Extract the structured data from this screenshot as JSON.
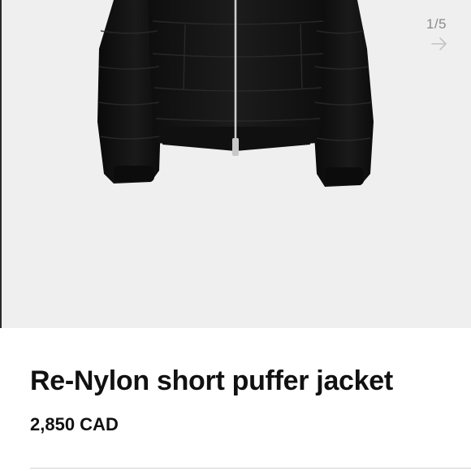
{
  "gallery": {
    "image_subject": "black puffer jacket",
    "counter": "1/5",
    "next_icon": "arrow-right-icon"
  },
  "product": {
    "title": "Re-Nylon short puffer jacket",
    "price": "2,850 CAD"
  },
  "colors": {
    "gallery_background": "#efeff0",
    "jacket": "#161616",
    "text": "#111111",
    "counter_text": "#8a8a8a"
  }
}
